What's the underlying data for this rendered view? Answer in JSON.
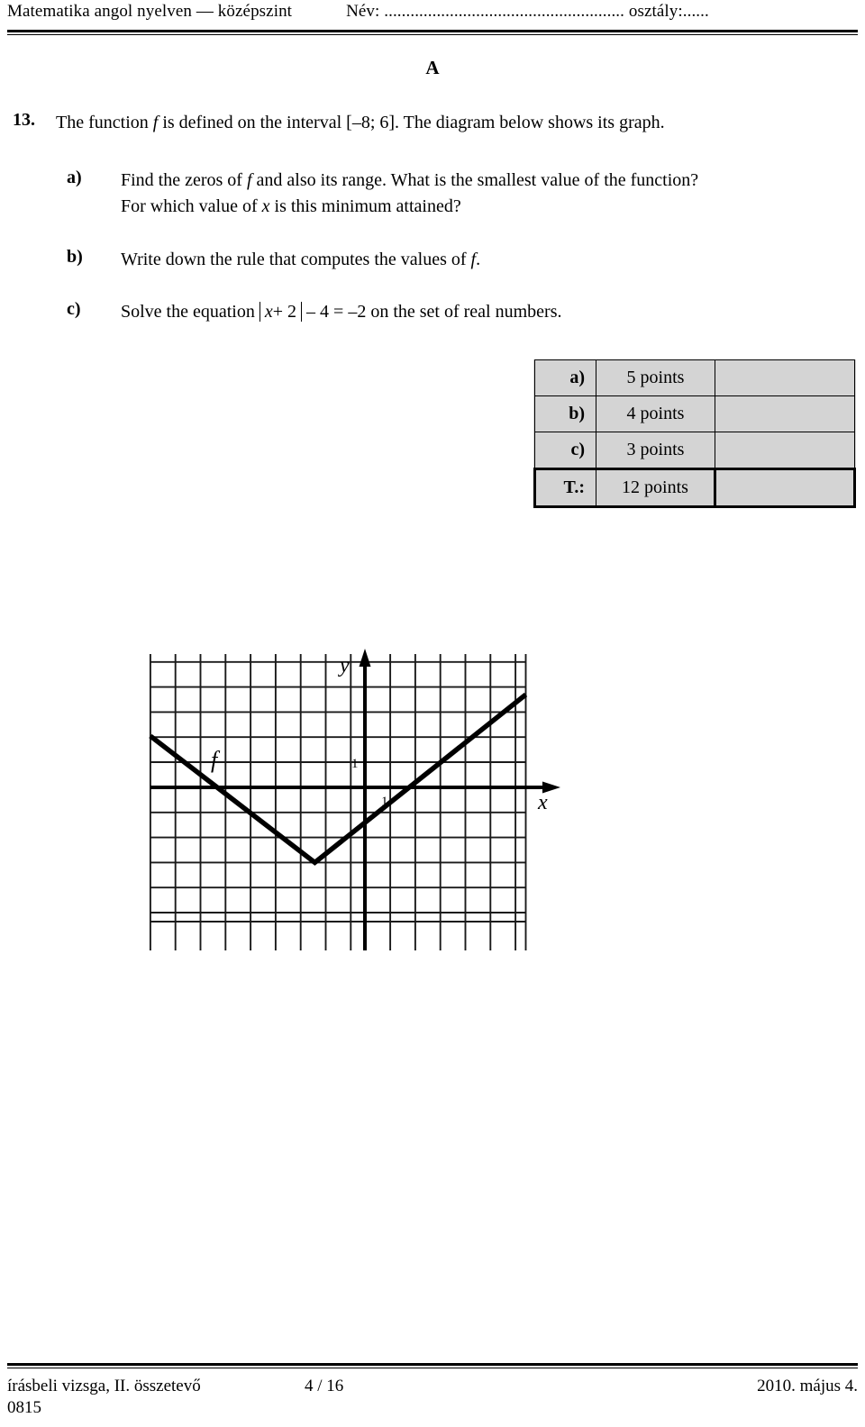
{
  "header": {
    "subject": "Matematika angol nyelven — középszint",
    "name_label": "Név: ....................................................... osztály:......"
  },
  "section_marker": "A",
  "problem": {
    "number": "13.",
    "stem_part1": "The function ",
    "stem_f": "f",
    "stem_part2": " is defined on the interval [",
    "stem_interval": "–8; 6",
    "stem_part3": "]. The diagram below shows its graph.",
    "parts": [
      {
        "label": "a)",
        "line1_a": "Find the zeros of ",
        "line1_f": "f",
        "line1_b": " and also its range. What is the smallest value of the function?",
        "line2_a": "For which value of ",
        "line2_x": "x",
        "line2_b": " is this minimum attained?"
      },
      {
        "label": "b)",
        "text_a": "Write down the rule that computes the values of ",
        "text_f": "f",
        "text_b": "."
      },
      {
        "label": "c)",
        "text_a": "Solve the equation",
        "expr_x": "x",
        "expr_plus2": "+ 2",
        "expr_minus4": "– 4 =",
        "expr_rhs": "–2",
        "text_b": "on the set of real numbers."
      }
    ]
  },
  "points_table": {
    "rows": [
      {
        "label": "a)",
        "value": "5 points",
        "blank": ""
      },
      {
        "label": "b)",
        "value": "4 points",
        "blank": ""
      },
      {
        "label": "c)",
        "value": "3 points",
        "blank": ""
      }
    ],
    "total": {
      "label": "T.:",
      "value": "12 points",
      "blank": ""
    }
  },
  "graph": {
    "x_axis_label": "x",
    "y_axis_label": "y",
    "function_label": "f",
    "unit_label_x": "1",
    "unit_label_y": "1"
  },
  "chart_data": {
    "type": "line",
    "title": "",
    "xlabel": "x",
    "ylabel": "y",
    "series": [
      {
        "name": "f",
        "points": [
          [
            -8.5,
            2.05
          ],
          [
            -2,
            -3
          ],
          [
            6.4,
            3.1
          ]
        ],
        "label": "f"
      }
    ],
    "xlim": [
      -8.55,
      6.45
    ],
    "ylim": [
      -5.15,
      5.2
    ],
    "grid": true,
    "grid_step": 1,
    "legend": "none",
    "annotations": [
      "f",
      "1",
      "1"
    ],
    "vertex": [
      -2,
      -3
    ],
    "zeros": [
      -5,
      1
    ],
    "domain": [
      -8,
      6
    ]
  },
  "footer": {
    "left": "írásbeli vizsga, II. összetevő",
    "page": "4 / 16",
    "date": "2010. május 4.",
    "code": "0815"
  }
}
